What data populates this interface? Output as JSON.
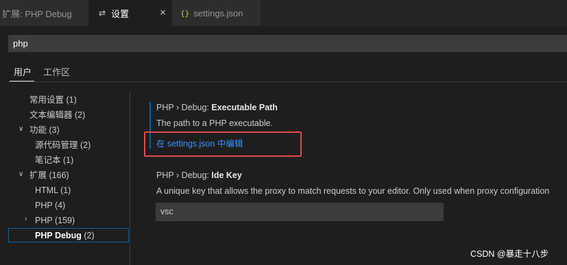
{
  "tabs": [
    {
      "label": "扩展: PHP Debug"
    },
    {
      "label": "设置",
      "close": "×"
    },
    {
      "label": "settings.json",
      "icon": "{}"
    }
  ],
  "search": {
    "value": "php"
  },
  "scopes": {
    "user": "用户",
    "workspace": "工作区"
  },
  "tree": [
    {
      "label": "常用设置",
      "count": "(1)"
    },
    {
      "label": "文本编辑器",
      "count": "(2)"
    },
    {
      "label": "功能",
      "count": "(3)"
    },
    {
      "label": "源代码管理",
      "count": "(2)"
    },
    {
      "label": "笔记本",
      "count": "(1)"
    },
    {
      "label": "扩展",
      "count": "(166)"
    },
    {
      "label": "HTML",
      "count": "(1)"
    },
    {
      "label": "PHP",
      "count": "(4)"
    },
    {
      "label": "PHP",
      "count": "(159)"
    },
    {
      "label": "PHP Debug",
      "count": "(2)"
    }
  ],
  "settings": [
    {
      "path": "PHP › Debug: ",
      "name": "Executable Path",
      "description": "The path to a PHP executable.",
      "link": "在 settings.json 中编辑"
    },
    {
      "path": "PHP › Debug: ",
      "name": "Ide Key",
      "description": "A unique key that allows the proxy to match requests to your editor. Only used when proxy configuration",
      "value": "vsc"
    }
  ],
  "watermark": "CSDN @暴走十八步",
  "colors": {
    "accent": "#0e639c",
    "link": "#3794ff",
    "highlight": "#e44b4b"
  }
}
